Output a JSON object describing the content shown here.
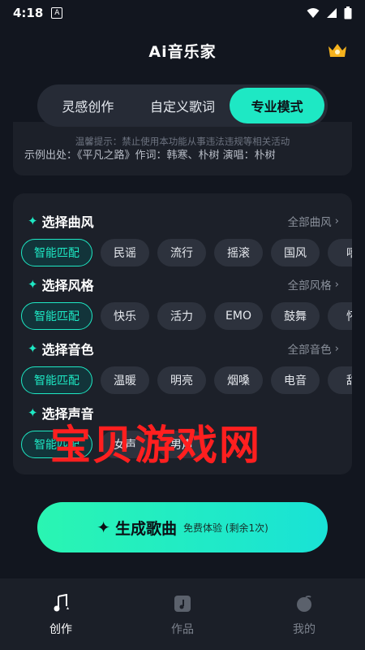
{
  "status_bar": {
    "time": "4:18",
    "notification_badge": "A"
  },
  "header": {
    "title": "Ai音乐家",
    "crown_icon": "crown-icon"
  },
  "mode_tabs": [
    {
      "label": "灵感创作",
      "active": false
    },
    {
      "label": "自定义歌词",
      "active": false
    },
    {
      "label": "专业模式",
      "active": true
    }
  ],
  "notice": "温馨提示：禁止使用本功能从事违法违规等相关活动",
  "lyrics_preview": "示例出处：《平凡之路》作词：韩寒、朴树 演唱：朴树",
  "sections": {
    "genre": {
      "title": "选择曲风",
      "more": "全部曲风",
      "chips": [
        "智能匹配",
        "民谣",
        "流行",
        "摇滚",
        "国风",
        "嘻"
      ]
    },
    "style": {
      "title": "选择风格",
      "more": "全部风格",
      "chips": [
        "智能匹配",
        "快乐",
        "活力",
        "EMO",
        "鼓舞",
        "怀"
      ]
    },
    "timbre": {
      "title": "选择音色",
      "more": "全部音色",
      "chips": [
        "智能匹配",
        "温暖",
        "明亮",
        "烟嗓",
        "电音",
        "甜"
      ]
    },
    "voice": {
      "title": "选择声音",
      "chips": [
        "智能匹配",
        "女声",
        "男声"
      ]
    }
  },
  "watermark": "宝贝游戏网",
  "generate": {
    "label": "生成歌曲",
    "sub": "免费体验 (剩余1次)"
  },
  "bottom_nav": [
    {
      "label": "创作",
      "active": true
    },
    {
      "label": "作品",
      "active": false
    },
    {
      "label": "我的",
      "active": false
    }
  ],
  "colors": {
    "accent": "#1ee8c4",
    "background": "#12161f",
    "card": "#1c2029",
    "chip": "#2d323d"
  }
}
